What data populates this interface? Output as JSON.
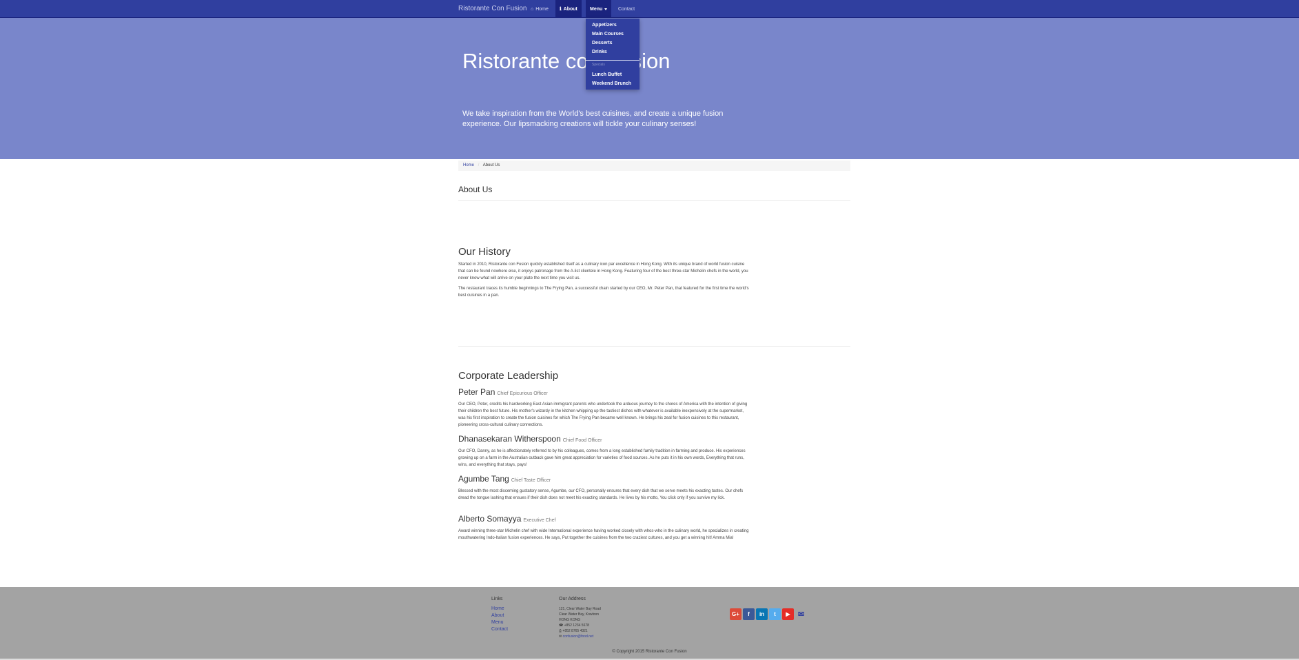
{
  "navbar": {
    "brand": "Ristorante Con Fusion",
    "items": [
      {
        "label": "Home",
        "icon": "home-icon",
        "glyph": "⌂"
      },
      {
        "label": "About",
        "icon": "info-icon",
        "glyph": "ℹ"
      },
      {
        "label": "Menu"
      },
      {
        "label": "Contact"
      }
    ]
  },
  "dropdown": {
    "items": [
      "Appetizers",
      "Main Courses",
      "Desserts",
      "Drinks"
    ],
    "header": "Specials",
    "specials": [
      "Lunch Buffet",
      "Weekend Brunch"
    ]
  },
  "jumbotron": {
    "title": "Ristorante con Fusion",
    "text": "We take inspiration from the World's best cuisines, and create a unique fusion experience. Our lipsmacking creations will tickle your culinary senses!"
  },
  "breadcrumb": {
    "home": "Home",
    "current": "About Us"
  },
  "page_heading": "About Us",
  "history": {
    "heading": "Our History",
    "p1": "Started in 2010, Ristorante con Fusion quickly established itself as a culinary icon par excellence in Hong Kong. With its unique brand of world fusion cuisine that can be found nowhere else, it enjoys patronage from the A-list clientele in Hong Kong. Featuring four of the best three-star Michelin chefs in the world, you never know what will arrive on your plate the next time you visit us.",
    "p2": "The restaurant traces its humble beginnings to The Frying Pan, a successful chain started by our CEO, Mr. Peter Pan, that featured for the first time the world's best cuisines in a pan."
  },
  "leadership": {
    "heading": "Corporate Leadership",
    "leaders": [
      {
        "name": "Peter Pan",
        "title": "Chief Epicurious Officer",
        "bio": "Our CEO, Peter, credits his hardworking East Asian immigrant parents who undertook the arduous journey to the shores of America with the intention of giving their children the best future. His mother's wizardy in the kitchen whipping up the tastiest dishes with whatever is available inexpensively at the supermarket, was his first inspiration to create the fusion cuisines for which The Frying Pan became well known. He brings his zeal for fusion cuisines to this restaurant, pioneering cross-cultural culinary connections."
      },
      {
        "name": "Dhanasekaran Witherspoon",
        "title": "Chief Food Officer",
        "bio": "Our CFO, Danny, as he is affectionately referred to by his colleagues, comes from a long established family tradition in farming and produce. His experiences growing up on a farm in the Australian outback gave him great appreciation for varieties of food sources. As he puts it in his own words, Everything that runs, wins, and everything that stays, pays!"
      },
      {
        "name": "Agumbe Tang",
        "title": "Chief Taste Officer",
        "bio": "Blessed with the most discerning gustatory sense, Agumbe, our CFO, personally ensures that every dish that we serve meets his exacting tastes. Our chefs dread the tongue lashing that ensues if their dish does not meet his exacting standards. He lives by his motto, You click only if you survive my lick."
      },
      {
        "name": "Alberto Somayya",
        "title": "Executive Chef",
        "bio": "Award winning three-star Michelin chef with wide International experience having worked closely with whos-who in the culinary world, he specializes in creating mouthwatering Indo-Italian fusion experiences. He says, Put together the cuisines from the two craziest cultures, and you get a winning hit! Amma Mia!"
      }
    ]
  },
  "footer": {
    "links_heading": "Links",
    "links": [
      "Home",
      "About",
      "Menu",
      "Contact"
    ],
    "address_heading": "Our Address",
    "address_lines": [
      "121, Clear Water Bay Road",
      "Clear Water Bay, Kowloon",
      "HONG KONG"
    ],
    "phone": "+852 1234 5678",
    "fax": "+852 8765 4321",
    "email": "confusion@food.net",
    "copyright": "© Copyright 2015 Ristorante Con Fusion",
    "social": [
      {
        "name": "google-plus-icon",
        "glyph": "G+",
        "color": "#dd4b39"
      },
      {
        "name": "facebook-icon",
        "glyph": "f",
        "color": "#3b5998"
      },
      {
        "name": "linkedin-icon",
        "glyph": "in",
        "color": "#0976b4"
      },
      {
        "name": "twitter-icon",
        "glyph": "t",
        "color": "#55acee"
      },
      {
        "name": "youtube-icon",
        "glyph": "▶",
        "color": "#e52d27"
      }
    ],
    "mail_glyph": "✉",
    "phone_glyph": "☎",
    "fax_glyph": "⎙"
  }
}
